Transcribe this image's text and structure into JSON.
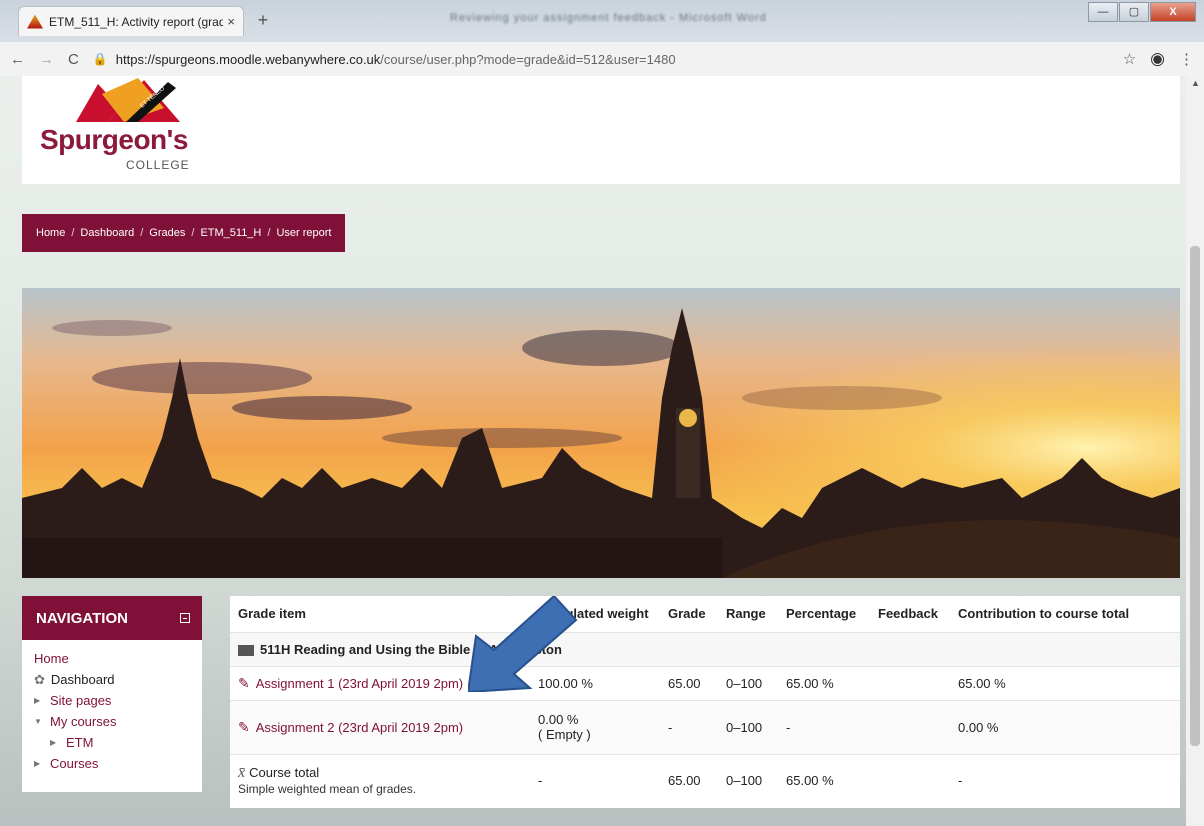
{
  "browser": {
    "tab_title": "ETM_511_H: Activity report (grad",
    "tab_close": "×",
    "new_tab": "+",
    "window_title": "Reviewing your assignment feedback - Microsoft Word",
    "url_host": "https://spurgeons.moodle.webanywhere.co.uk",
    "url_path": "/course/user.php?mode=grade&id=512&user=1480",
    "controls": {
      "minimize": "—",
      "maximize": "▢",
      "close": "X"
    }
  },
  "site": {
    "logo_name": "Spurgeon's",
    "logo_sub": "COLLEGE"
  },
  "breadcrumb": [
    "Home",
    "Dashboard",
    "Grades",
    "ETM_511_H",
    "User report"
  ],
  "navigation": {
    "title": "NAVIGATION",
    "items": {
      "home": "Home",
      "dashboard": "Dashboard",
      "site_pages": "Site pages",
      "my_courses": "My courses",
      "etm": "ETM",
      "courses": "Courses"
    }
  },
  "grades": {
    "headers": {
      "item": "Grade item",
      "weight": "Calculated weight",
      "grade": "Grade",
      "range": "Range",
      "percentage": "Percentage",
      "feedback": "Feedback",
      "contribution": "Contribution to course total"
    },
    "category": "511H Reading and Using the Bible [MA1] - Histon",
    "rows": [
      {
        "name": "Assignment 1 (23rd April 2019 2pm)",
        "weight": "100.00 %",
        "weight_note": "",
        "grade": "65.00",
        "range": "0–100",
        "percentage": "65.00 %",
        "feedback": "",
        "contribution": "65.00 %"
      },
      {
        "name": "Assignment 2 (23rd April 2019 2pm)",
        "weight": "0.00 %",
        "weight_note": "( Empty )",
        "grade": "-",
        "range": "0–100",
        "percentage": "-",
        "feedback": "",
        "contribution": "0.00 %"
      }
    ],
    "total": {
      "name": "Course total",
      "note": "Simple weighted mean of grades.",
      "weight": "-",
      "grade": "65.00",
      "range": "0–100",
      "percentage": "65.00 %",
      "contribution": "-"
    }
  },
  "colors": {
    "brand": "#7f1038",
    "arrow": "#3e6fb3"
  }
}
